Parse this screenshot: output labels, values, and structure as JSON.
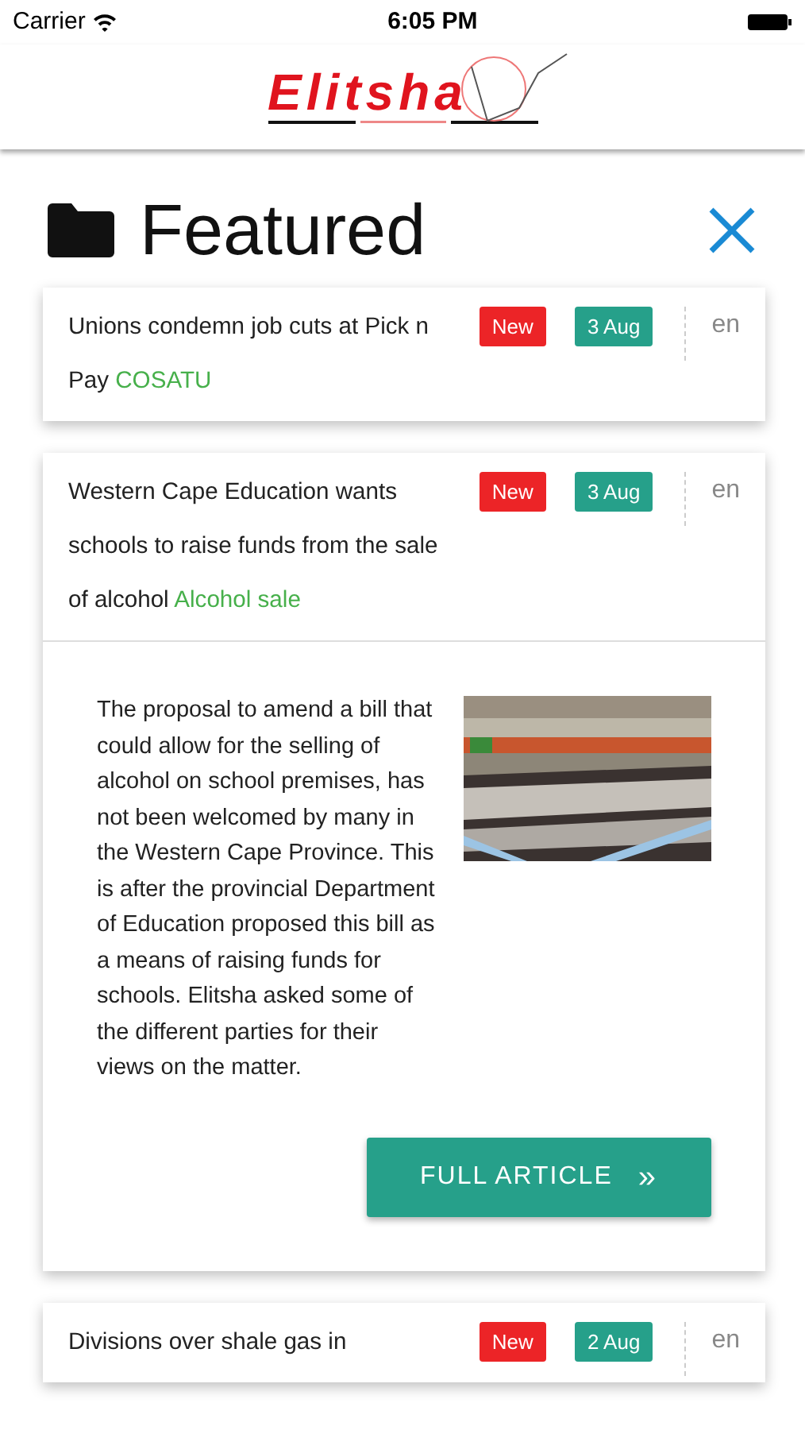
{
  "status_bar": {
    "carrier": "Carrier",
    "time": "6:05 PM"
  },
  "header": {
    "logo": "Elitsha"
  },
  "page": {
    "title": "Featured"
  },
  "articles": [
    {
      "title": "Unions condemn job cuts at Pick n Pay",
      "tag": "COSATU",
      "badge": "New",
      "date": "3 Aug",
      "language": "en",
      "expanded": false
    },
    {
      "title": "Western Cape Education wants schools to raise funds from the sale of alcohol",
      "tag": "Alcohol sale",
      "badge": "New",
      "date": "3 Aug",
      "language": "en",
      "expanded": true,
      "summary": "The proposal to amend a bill that could allow for the selling of alcohol on school premises, has not been welcomed by many in the Western Cape Province. This is after the provincial Department of Education proposed this bill as a means of raising funds for schools. Elitsha asked some of the different parties for their views on the matter.",
      "button": "FULL ARTICLE",
      "button_icon": "»"
    },
    {
      "title": "Divisions over shale gas in",
      "badge": "New",
      "date": "2 Aug",
      "language": "en",
      "expanded": false
    }
  ]
}
